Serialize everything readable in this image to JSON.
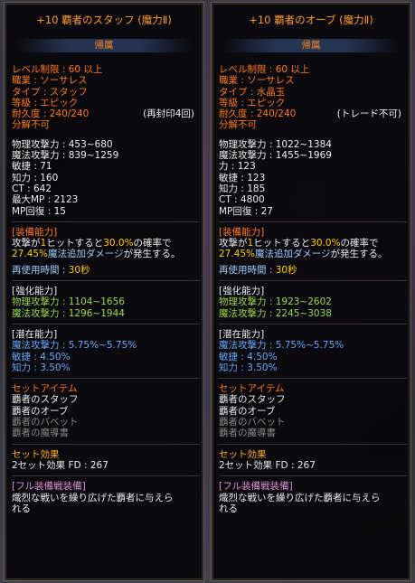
{
  "left": {
    "title": "+10 覇者のスタッフ (魔力Ⅱ)",
    "bound": "帰属",
    "req": "レベル制限 : 60 以上",
    "job": "職業 : ソーサレス",
    "type": "タイプ : スタッフ",
    "grade": "等級 : エピック",
    "dur": "耐久度 : 240/240",
    "dur_note": "(再封印4回)",
    "nodisassemble": "分解不可",
    "stats": [
      "物理攻撃力 : 453~680",
      "魔法攻撃力 : 839~1259",
      "敏捷 : 71",
      "知力 : 160",
      "CT : 642",
      "最大MP : 2123",
      "MP回復 : 15"
    ],
    "equip_header": "[装備能力]",
    "equip_line1_a": "攻撃が",
    "equip_line1_b": "1",
    "equip_line1_c": "ヒットすると",
    "equip_line1_d": "30.0%",
    "equip_line1_e": "の確率で",
    "equip_line2_a": "27.45%",
    "equip_line2_b": "魔法追加ダメージ",
    "equip_line2_c": "が発生する。",
    "cooldown_a": "再使用時間 : ",
    "cooldown_b": "30秒",
    "enhance_header": "[強化能力]",
    "enhance": [
      "物理攻撃力 : 1104~1656",
      "魔法攻撃力 : 1296~1944"
    ],
    "potential_header": "[潜在能力]",
    "potential": [
      "魔法攻撃力 : 5.75%~5.75%",
      "敏捷 : 4.50%",
      "知力 : 3.50%"
    ],
    "set_header": "セットアイテム",
    "set_items_on": [
      "覇者のスタッフ",
      "覇者のオーブ"
    ],
    "set_items_off": [
      "覇者のバベット",
      "覇者の魔導書"
    ],
    "set_effect_header": "セット効果",
    "set_effect": "2セット効果 FD : 267",
    "full_header": "[フル装備戦装備]",
    "full_line1": "熾烈な戦いを繰り広げた覇者に与えら",
    "full_line2": "れる"
  },
  "right": {
    "title": "+10 覇者のオーブ (魔力Ⅱ)",
    "bound": "帰属",
    "req": "レベル制限 : 60 以上",
    "job": "職業 : ソーサレス",
    "type": "タイプ : 水晶玉",
    "grade": "等級 : エピック",
    "dur": "耐久度 : 240/240",
    "dur_note": "(トレード不可)",
    "nodisassemble": "分解不可",
    "stats": [
      "物理攻撃力 : 1022~1384",
      "魔法攻撃力 : 1455~1969",
      "力 : 123",
      "敏捷 : 123",
      "知力 : 185",
      "CT : 4800",
      "MP回復 : 27"
    ],
    "equip_header": "[装備能力]",
    "equip_line1_a": "攻撃が",
    "equip_line1_b": "1",
    "equip_line1_c": "ヒットすると",
    "equip_line1_d": "30.0%",
    "equip_line1_e": "の確率で",
    "equip_line2_a": "27.45%",
    "equip_line2_b": "魔法追加ダメージ",
    "equip_line2_c": "が発生する。",
    "cooldown_a": "再使用時間 : ",
    "cooldown_b": "30秒",
    "enhance_header": "[強化能力]",
    "enhance": [
      "物理攻撃力 : 1923~2602",
      "魔法攻撃力 : 2245~3038"
    ],
    "potential_header": "[潜在能力]",
    "potential": [
      "魔法攻撃力 : 5.75%~5.75%",
      "敏捷 : 4.50%",
      "知力 : 3.50%"
    ],
    "set_header": "セットアイテム",
    "set_items_on": [
      "覇者のスタッフ",
      "覇者のオーブ"
    ],
    "set_items_off": [
      "覇者のバベット",
      "覇者の魔導書"
    ],
    "set_effect_header": "セット効果",
    "set_effect": "2セット効果 FD : 267",
    "full_header": "[フル装備戦装備]",
    "full_line1": "熾烈な戦いを繰り広げた覇者に与えら",
    "full_line2": "れる"
  }
}
